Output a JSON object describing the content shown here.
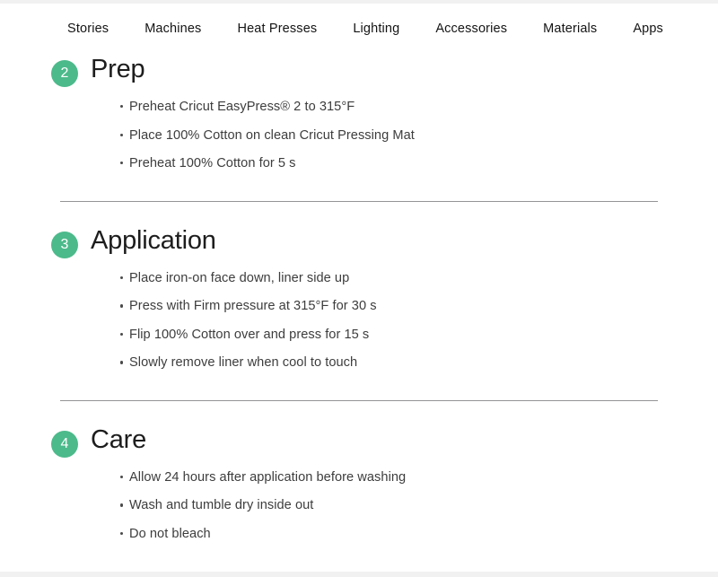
{
  "chrome": {
    "top_band_color": "#f1f1f2",
    "bottom_band_color": "#f1f1f2"
  },
  "nav": {
    "items": [
      {
        "label": "Stories"
      },
      {
        "label": "Machines"
      },
      {
        "label": "Heat Presses"
      },
      {
        "label": "Lighting"
      },
      {
        "label": "Accessories"
      },
      {
        "label": "Materials"
      },
      {
        "label": "Apps"
      }
    ]
  },
  "theme": {
    "badge_green": "#4cba8b",
    "heading_color": "#1d1d1d",
    "body_color": "#3d3d3d",
    "divider_color": "#949497"
  },
  "sections": [
    {
      "number": "2",
      "title": "Prep",
      "bullets": [
        "Preheat Cricut EasyPress® 2 to 315°F",
        "Place 100% Cotton on clean Cricut Pressing Mat",
        "Preheat 100% Cotton for 5 s"
      ]
    },
    {
      "number": "3",
      "title": "Application",
      "bullets": [
        "Place iron-on face down, liner side up",
        "Press with Firm pressure at 315°F for 30 s",
        "Flip 100% Cotton over and press for 15 s",
        "Slowly remove liner when cool to touch"
      ]
    },
    {
      "number": "4",
      "title": "Care",
      "bullets": [
        "Allow 24 hours after application before washing",
        "Wash and tumble dry inside out",
        "Do not bleach"
      ]
    }
  ]
}
